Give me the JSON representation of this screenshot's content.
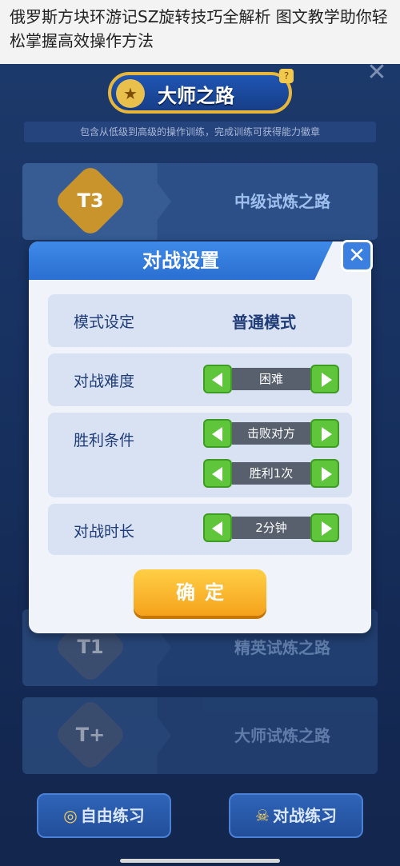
{
  "caption": {
    "text": "俄罗斯方块环游记SZ旋转技巧全解析 图文教学助你轻松掌握高效操作方法"
  },
  "banner": {
    "title": "大师之路",
    "help": "?"
  },
  "subtitle": "包含从低级到高级的操作训练，完成训练可获得能力徽章",
  "levels": [
    {
      "badge": "T3",
      "label": "中级试炼之路",
      "color": "#c9942c"
    },
    {
      "badge": "T1",
      "label": "精英试炼之路",
      "color": "#5a6a86"
    },
    {
      "badge": "T+",
      "label": "大师试炼之路",
      "color": "#5a6a86"
    }
  ],
  "dialog": {
    "title": "对战设置",
    "close_icon": "close-icon",
    "rows": [
      {
        "label": "模式设定",
        "value": "普通模式"
      },
      {
        "label": "对战难度",
        "value": "困难"
      },
      {
        "label": "胜利条件",
        "value": "击败对方",
        "value2": "胜利1次"
      },
      {
        "label": "对战时长",
        "value": "2分钟"
      }
    ],
    "confirm": "确定"
  },
  "bottom": {
    "free_practice": "自由练习",
    "battle_practice": "对战练习"
  }
}
